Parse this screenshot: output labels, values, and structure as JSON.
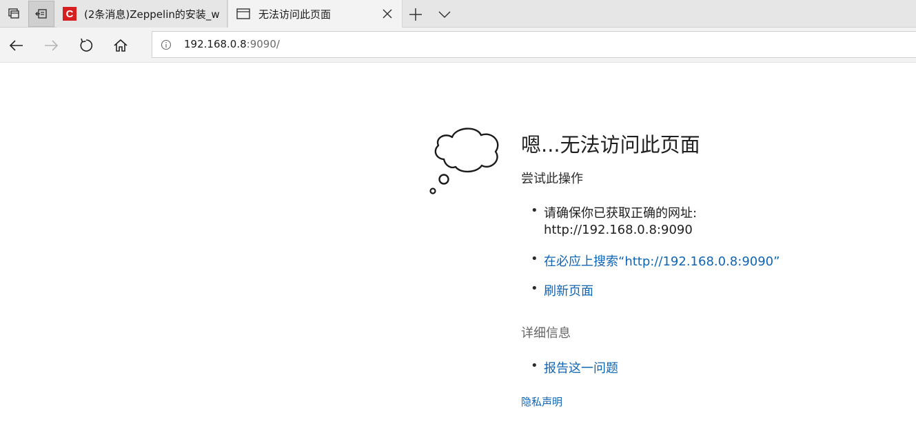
{
  "browser": {
    "tabs": [
      {
        "title": "(2条消息)Zeppelin的安装_w",
        "favicon": "C",
        "favicon_color": "#d71f1f",
        "active": false
      },
      {
        "title": "无法访问此页面",
        "favicon": "page-icon",
        "active": true
      }
    ],
    "address": {
      "host": "192.168.0.8",
      "rest": ":9090/"
    }
  },
  "error_page": {
    "title": "嗯...无法访问此页面",
    "subtitle": "尝试此操作",
    "suggestion_1": "请确保你已获取正确的网址:",
    "suggestion_1_url": "http://192.168.0.8:9090",
    "search_link": "在必应上搜索“http://192.168.0.8:9090”",
    "refresh_link": "刷新页面",
    "details_heading": "详细信息",
    "report_link": "报告这一问题",
    "privacy_link": "隐私声明"
  },
  "colors": {
    "link": "#0f64b4",
    "tab_strip": "#e6e6e6",
    "toolbar": "#f3f3f3"
  }
}
